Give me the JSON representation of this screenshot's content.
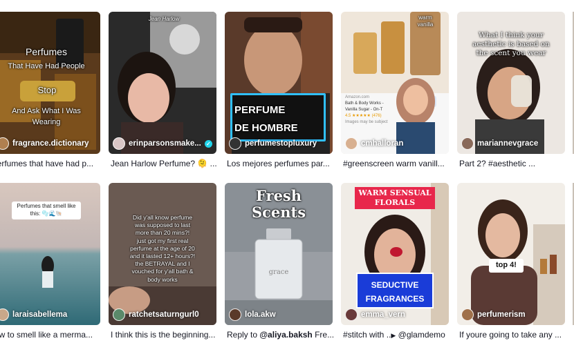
{
  "cards": [
    {
      "username": "fragrance.dictionary",
      "caption": "perfumes that have had p...",
      "overlay": [
        "Perfumes",
        "That Have Had People",
        "Stop",
        "And Ask What I Was",
        "Wearing"
      ]
    },
    {
      "username": "erinparsonsmake...",
      "caption": "Jean Harlow Perfume? 🫠 ...",
      "overlay": [
        "Jean Harlow"
      ]
    },
    {
      "username": "perfumestopluxury",
      "caption": "Los mejores perfumes par...",
      "overlay": [
        "PERFUME",
        "DE HOMBRE"
      ]
    },
    {
      "username": "cmhalloran",
      "caption": "#greenscreen warm vanill...",
      "overlay": [
        "warm",
        "vanilla",
        "Amazon.com",
        "Bath & Body Works -",
        "Vanilla Sugar - On-T",
        "4.5 ★★★★★ (476)",
        "Images may be subject"
      ]
    },
    {
      "username": "mariannevgrace",
      "caption": "Part 2? #aesthetic ...",
      "overlay": [
        "What I think your",
        "aesthetic is based on",
        "the scent you wear"
      ]
    },
    {
      "username": "laraisabellema",
      "caption": "ow to smell like a merma...",
      "overlay": [
        "Perfumes that smell like",
        "this: 🫧🌊🐚"
      ]
    },
    {
      "username": "ratchetsaturngurl0",
      "caption": "I think this is the beginning...",
      "overlay": [
        "Did y'all know perfume",
        "was supposed to last",
        "more than 20 mins?!",
        "just got my first real",
        "perfume at the age of 20",
        "and it lasted 12+ hours?!",
        "the BETRAYAL and I",
        "vouched for y'all bath &",
        "body works"
      ]
    },
    {
      "username": "lola.akw",
      "caption_prefix": "Reply to ",
      "caption_mention": "@aliya.baksh",
      "caption_suffix": " Fre...",
      "overlay": [
        "Fresh",
        "Scents",
        "grace"
      ]
    },
    {
      "username": "emma_vern",
      "caption_prefix": "#stitch with ",
      "caption_icon": "▶",
      "caption_mention": "@glamdemo",
      "caption_suffix": "",
      "overlay": [
        "WARM SENSUAL",
        "FLORALS",
        "SEDUCTIVE",
        "FRAGRANCES"
      ]
    },
    {
      "username": "perfumerism",
      "caption": "If youre going to take any ...",
      "overlay": [
        "top 4!"
      ]
    }
  ],
  "colors": {
    "verified": "#20d5ec",
    "pink_banner": "#e8274b",
    "blue_box": "#1a3cd8"
  }
}
